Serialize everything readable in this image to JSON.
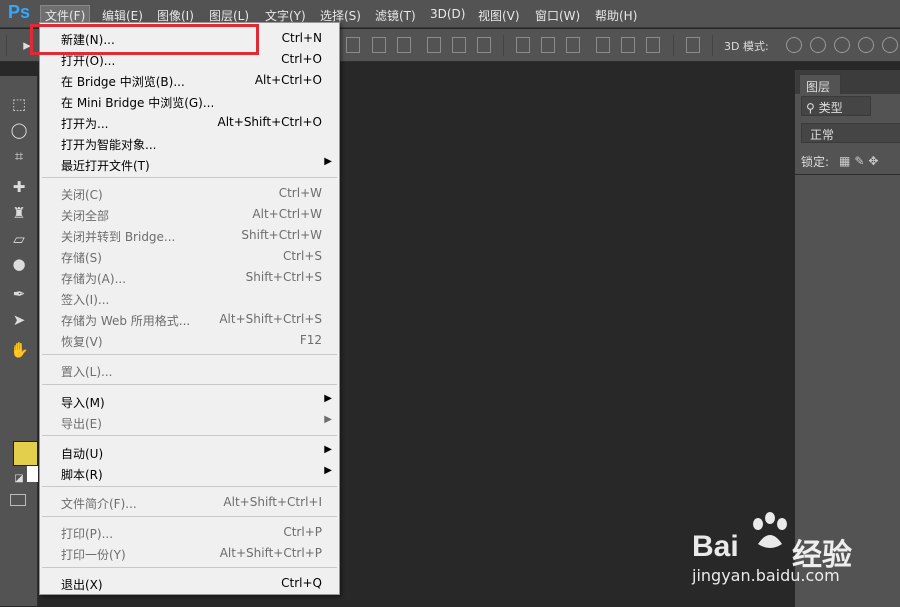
{
  "app": {
    "logo": "Ps"
  },
  "menubar": {
    "items": [
      "文件(F)",
      "编辑(E)",
      "图像(I)",
      "图层(L)",
      "文字(Y)",
      "选择(S)",
      "滤镜(T)",
      "3D(D)",
      "视图(V)",
      "窗口(W)",
      "帮助(H)"
    ]
  },
  "options_bar": {
    "mode_label": "3D 模式:"
  },
  "layers_panel": {
    "tab": "图层",
    "filter": "类型",
    "blend_mode": "正常",
    "lock_label": "锁定:"
  },
  "file_menu": {
    "items": [
      {
        "label": "新建(N)...",
        "shortcut": "Ctrl+N",
        "disabled": false
      },
      {
        "label": "打开(O)...",
        "shortcut": "Ctrl+O",
        "disabled": false
      },
      {
        "label": "在 Bridge 中浏览(B)...",
        "shortcut": "Alt+Ctrl+O",
        "disabled": false
      },
      {
        "label": "在 Mini Bridge 中浏览(G)...",
        "shortcut": "",
        "disabled": false
      },
      {
        "label": "打开为...",
        "shortcut": "Alt+Shift+Ctrl+O",
        "disabled": false
      },
      {
        "label": "打开为智能对象...",
        "shortcut": "",
        "disabled": false
      },
      {
        "label": "最近打开文件(T)",
        "shortcut": "",
        "disabled": false,
        "submenu": true
      },
      {
        "label": "关闭(C)",
        "shortcut": "Ctrl+W",
        "disabled": true
      },
      {
        "label": "关闭全部",
        "shortcut": "Alt+Ctrl+W",
        "disabled": true
      },
      {
        "label": "关闭并转到 Bridge...",
        "shortcut": "Shift+Ctrl+W",
        "disabled": true
      },
      {
        "label": "存储(S)",
        "shortcut": "Ctrl+S",
        "disabled": true
      },
      {
        "label": "存储为(A)...",
        "shortcut": "Shift+Ctrl+S",
        "disabled": true
      },
      {
        "label": "签入(I)...",
        "shortcut": "",
        "disabled": true
      },
      {
        "label": "存储为 Web 所用格式...",
        "shortcut": "Alt+Shift+Ctrl+S",
        "disabled": true
      },
      {
        "label": "恢复(V)",
        "shortcut": "F12",
        "disabled": true
      },
      {
        "label": "置入(L)...",
        "shortcut": "",
        "disabled": true
      },
      {
        "label": "导入(M)",
        "shortcut": "",
        "disabled": false,
        "submenu": true
      },
      {
        "label": "导出(E)",
        "shortcut": "",
        "disabled": true,
        "submenu": true
      },
      {
        "label": "自动(U)",
        "shortcut": "",
        "disabled": false,
        "submenu": true
      },
      {
        "label": "脚本(R)",
        "shortcut": "",
        "disabled": false,
        "submenu": true
      },
      {
        "label": "文件简介(F)...",
        "shortcut": "Alt+Shift+Ctrl+I",
        "disabled": true
      },
      {
        "label": "打印(P)...",
        "shortcut": "Ctrl+P",
        "disabled": true
      },
      {
        "label": "打印一份(Y)",
        "shortcut": "Alt+Shift+Ctrl+P",
        "disabled": true
      },
      {
        "label": "退出(X)",
        "shortcut": "Ctrl+Q",
        "disabled": false
      }
    ]
  },
  "watermark": {
    "brand_left": "Bai",
    "brand_right": "经验",
    "url": "jingyan.baidu.com"
  },
  "colors": {
    "foreground": "#e4cf4c",
    "background": "#ffffff",
    "highlight": "#e02a36"
  }
}
